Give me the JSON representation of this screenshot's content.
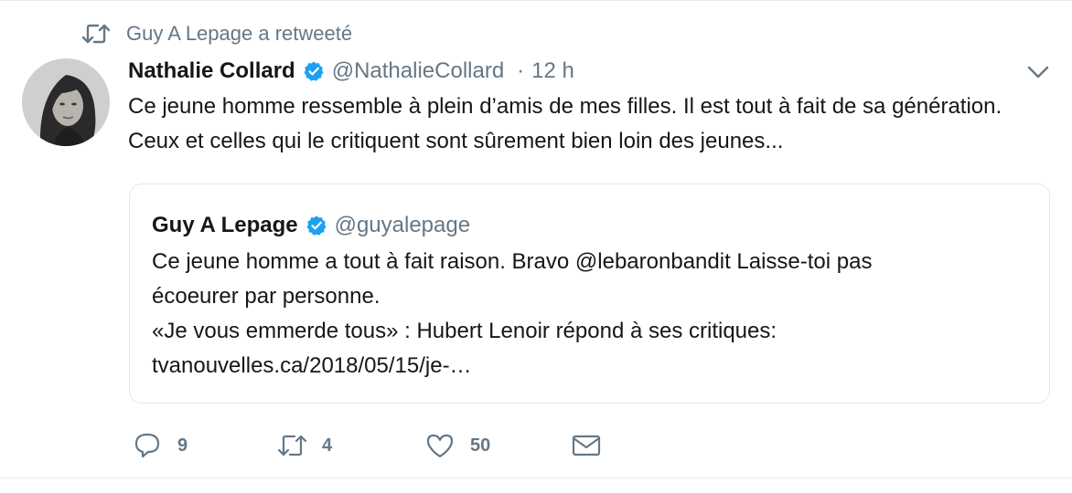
{
  "retweet_context": {
    "text": "Guy A Lepage a retweeté",
    "icon": "retweet-icon"
  },
  "tweet": {
    "author_name": "Nathalie Collard",
    "author_handle": "@NathalieCollard",
    "separator": "·",
    "time": "12 h",
    "verified": true,
    "text": "Ce jeune homme ressemble à plein d’amis de mes filles. Il est tout à fait de sa génération. Ceux et celles qui le critiquent sont sûrement bien loin des jeunes..."
  },
  "quoted_tweet": {
    "author_name": "Guy A Lepage",
    "author_handle": "@guyalepage",
    "verified": true,
    "lines": [
      "Ce jeune homme a tout à fait raison. Bravo @lebaronbandit Laisse-toi pas",
      "écoeurer par personne.",
      "«Je vous emmerde tous» : Hubert Lenoir répond à ses critiques:",
      "tvanouvelles.ca/2018/05/15/je-…"
    ]
  },
  "actions": {
    "reply_count": "9",
    "retweet_count": "4",
    "like_count": "50"
  },
  "colors": {
    "text": "#14171a",
    "secondary": "#657786",
    "verified_blue": "#1da1f2",
    "border": "#e1e8ed"
  }
}
